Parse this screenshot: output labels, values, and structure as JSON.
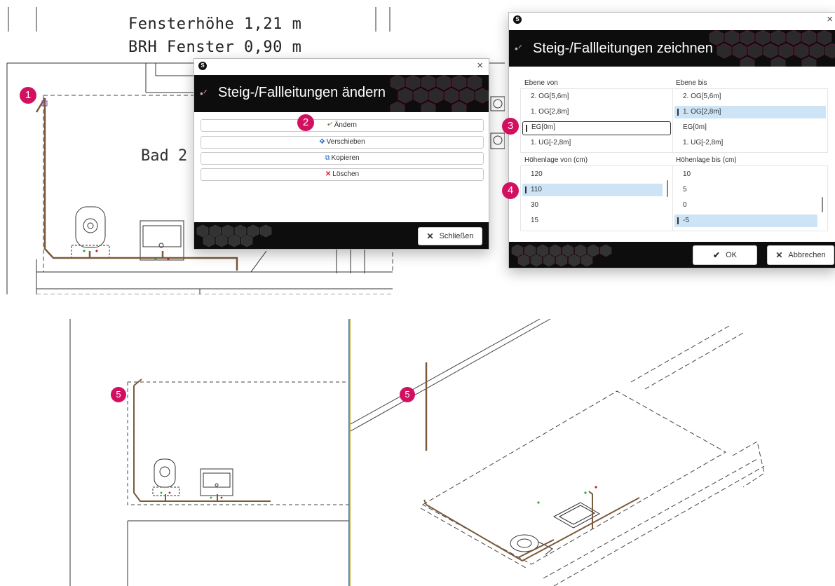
{
  "plan": {
    "window_height_text": "Fensterhöhe 1,21 m",
    "sill_height_text": "BRH Fenster 0,90 m",
    "room_label": "Bad 2"
  },
  "dialog_change": {
    "title": "Steig-/Fallleitungen ändern",
    "actions": [
      {
        "label": "Ändern",
        "icon": "pipe-edit-icon"
      },
      {
        "label": "Verschieben",
        "icon": "move-arrows-icon"
      },
      {
        "label": "Kopieren",
        "icon": "copy-icon"
      },
      {
        "label": "Löschen",
        "icon": "delete-x-icon"
      }
    ],
    "close_label": "Schließen"
  },
  "dialog_draw": {
    "title": "Steig-/Fallleitungen zeichnen",
    "level_from": {
      "label": "Ebene von",
      "items": [
        "2. OG[5,6m]",
        "1. OG[2,8m]",
        "EG[0m]",
        "1. UG[-2,8m]"
      ],
      "selected": "EG[0m]"
    },
    "level_to": {
      "label": "Ebene bis",
      "items": [
        "2. OG[5,6m]",
        "1. OG[2,8m]",
        "EG[0m]",
        "1. UG[-2,8m]"
      ],
      "selected": "1. OG[2,8m]"
    },
    "height_from": {
      "label": "Höhenlage von (cm)",
      "items": [
        "120",
        "110",
        "30",
        "15"
      ],
      "selected": "110"
    },
    "height_to": {
      "label": "Höhenlage bis (cm)",
      "items": [
        "10",
        "5",
        "0",
        "-5"
      ],
      "selected": "-5"
    },
    "ok_label": "OK",
    "cancel_label": "Abbrechen"
  },
  "badges": [
    "1",
    "2",
    "3",
    "4",
    "5",
    "5"
  ],
  "colors": {
    "accent": "#d1115f",
    "pipe": "#7a5a3a",
    "banner": "#0d0d0d",
    "selection": "#cde4f7"
  }
}
